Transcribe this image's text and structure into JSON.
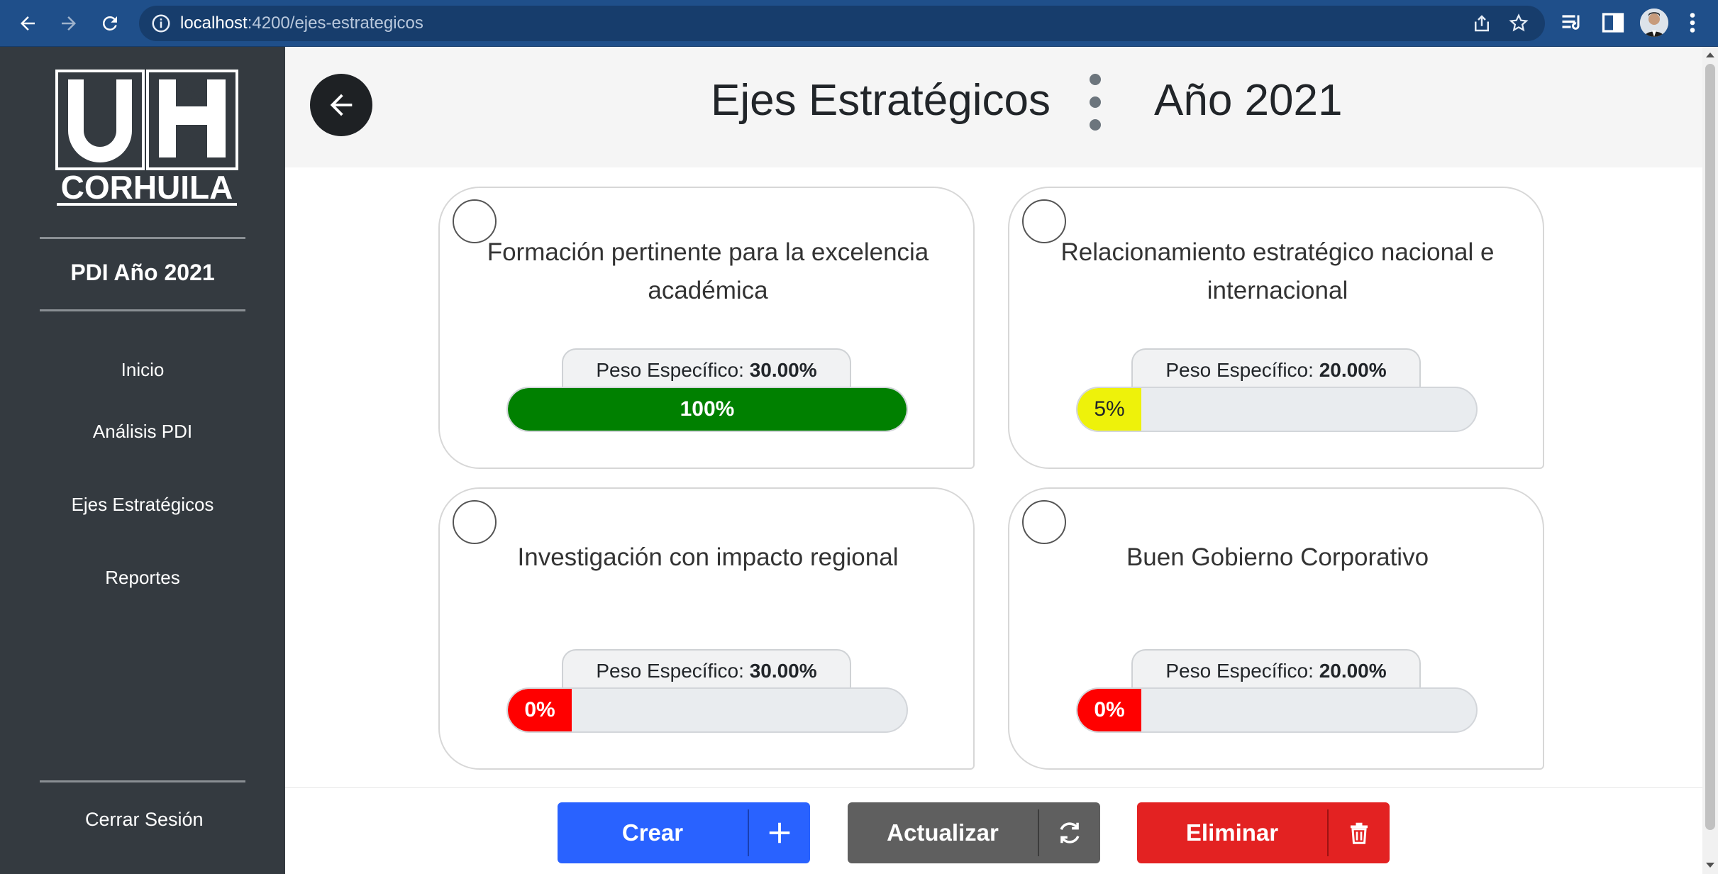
{
  "browser": {
    "url_host": "localhost",
    "url_path": ":4200/ejes-estrategicos"
  },
  "sidebar": {
    "logo_text": "CORHUILA",
    "title": "PDI Año 2021",
    "items": [
      {
        "label": "Inicio"
      },
      {
        "label": "Análisis PDI"
      },
      {
        "label": "Ejes Estratégicos"
      },
      {
        "label": "Reportes"
      }
    ],
    "logout_label": "Cerrar Sesión"
  },
  "header": {
    "title": "Ejes Estratégicos",
    "year": "Año 2021"
  },
  "cards": [
    {
      "title": "Formación pertinente para la excelencia académica",
      "weight_label": "Peso Específico:",
      "weight_value": "30.00%",
      "progress_text": "100%",
      "progress_fraction": 1.0,
      "progress_color": "#008000",
      "progress_text_color": "#ffffff"
    },
    {
      "title": "Relacionamiento estratégico nacional e internacional",
      "weight_label": "Peso Específico:",
      "weight_value": "20.00%",
      "progress_text": "5%",
      "progress_fraction": 0.05,
      "progress_color": "#eef20a",
      "progress_text_color": "#212529"
    },
    {
      "title": "Investigación con impacto regional",
      "weight_label": "Peso Específico:",
      "weight_value": "30.00%",
      "progress_text": "0%",
      "progress_fraction": 0.0,
      "progress_color": "#ff0000",
      "progress_text_color": "#ffffff"
    },
    {
      "title": "Buen Gobierno Corporativo",
      "weight_label": "Peso Específico:",
      "weight_value": "20.00%",
      "progress_text": "0%",
      "progress_fraction": 0.0,
      "progress_color": "#ff0000",
      "progress_text_color": "#ffffff"
    }
  ],
  "actions": {
    "create_label": "Crear",
    "update_label": "Actualizar",
    "delete_label": "Eliminar"
  },
  "colors": {
    "sidebar_bg": "#343a40",
    "create": "#2962ff",
    "update": "#5f5f5f",
    "delete": "#e32222"
  },
  "icons": [
    "back-arrow-icon",
    "forward-arrow-icon",
    "reload-icon",
    "info-icon",
    "share-icon",
    "star-icon",
    "reading-list-icon",
    "side-panel-icon",
    "profile-avatar",
    "more-vert-icon",
    "arrow-left-icon",
    "vertical-dots-icon",
    "plus-icon",
    "sync-icon",
    "trash-icon"
  ]
}
